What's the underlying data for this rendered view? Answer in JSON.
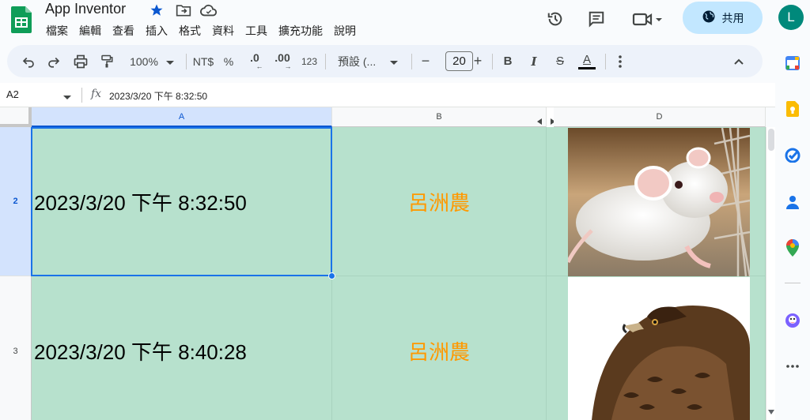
{
  "doc": {
    "title": "App Inventor"
  },
  "menu": [
    "檔案",
    "編輯",
    "查看",
    "插入",
    "格式",
    "資料",
    "工具",
    "擴充功能",
    "說明"
  ],
  "header": {
    "share_label": "共用",
    "avatar_letter": "L"
  },
  "toolbar": {
    "zoom": "100%",
    "currency": "NT$",
    "percent": "%",
    "dec_decrease": ".0",
    "dec_increase": ".00",
    "number_format": "123",
    "font_name": "預設 (...",
    "font_size": "20",
    "minus": "−",
    "plus": "+",
    "bold": "B",
    "italic": "I",
    "strike": "S",
    "text_color": "A"
  },
  "formula_bar": {
    "cell_ref": "A2",
    "fx": "fx",
    "content": "2023/3/20 下午 8:32:50"
  },
  "columns": [
    "A",
    "B",
    "D"
  ],
  "rows": [
    {
      "num": "2",
      "date": "2023/3/20 下午 8:32:50",
      "name": "呂洲農",
      "image": "white-mouse"
    },
    {
      "num": "3",
      "date": "2023/3/20 下午 8:40:28",
      "name": "呂洲農",
      "image": "hawk"
    }
  ],
  "colors": {
    "accent": "#1a73e8",
    "cell_fill": "#b7e1cd",
    "name_text": "#ff9900",
    "share_bg": "#c2e7ff",
    "avatar_bg": "#00897b"
  }
}
